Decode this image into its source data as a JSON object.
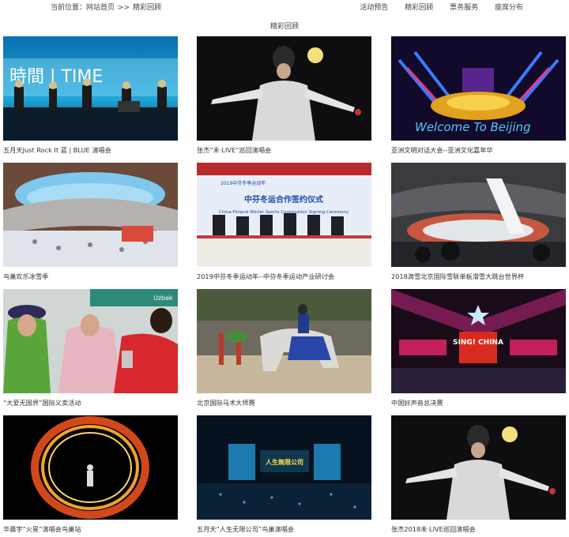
{
  "breadcrumb": {
    "label": "当前位置：",
    "home": "网站首页",
    "separator": ">>",
    "current": "精彩回顾"
  },
  "nav": [
    "活动预告",
    "精彩回顾",
    "票务服务",
    "座席分布"
  ],
  "section_title": "精彩回顾",
  "cards": [
    {
      "caption": "五月天Just Rock It 蓝 | BLUE 演唱会",
      "thumb_text": "時間 | TIME"
    },
    {
      "caption": "张杰“未·LIVE”巡回演唱会"
    },
    {
      "caption": "亚洲文明对话大会--亚洲文化嘉年华",
      "thumb_text": "Welcome To Beijing"
    },
    {
      "caption": "鸟巢欢乐冰雪季"
    },
    {
      "caption": "2019中芬冬季运动年--中芬冬季运动产业研讨会",
      "thumb_title": "中芬冬运合作签约仪式",
      "thumb_sub": "China-Finland Winter Sports Cooperation Signing Ceremony",
      "thumb_header": "2019中芬冬季运动年"
    },
    {
      "caption": "2018滴雪北京国际雪联单板滑雪大跳台世界杯"
    },
    {
      "caption": "“大爱无国界”国际义卖活动",
      "thumb_text": "Uzbek"
    },
    {
      "caption": "北京国际马术大师赛"
    },
    {
      "caption": "中国好声音总决赛",
      "thumb_text": "SING! CHINA"
    },
    {
      "caption": "华晨宇“火星”演唱会鸟巢站"
    },
    {
      "caption": "五月天“人生无限公司”鸟巢演唱会",
      "thumb_text": "人生無限公司"
    },
    {
      "caption": "张杰2018未·LIVE巡回演唱会"
    }
  ]
}
